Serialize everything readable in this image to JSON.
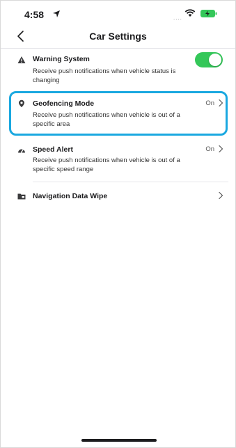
{
  "status_bar": {
    "time": "4:58",
    "signal_dots": "....",
    "icons": [
      "location-arrow-icon",
      "wifi-icon",
      "battery-charging-icon"
    ]
  },
  "nav": {
    "title": "Car Settings",
    "back_icon": "chevron-left-icon"
  },
  "settings": [
    {
      "title": "Warning System",
      "description": "Receive push notifications when vehicle status is changing",
      "icon": "warning-triangle-icon",
      "control": "toggle",
      "toggle_on": true
    },
    {
      "title": "Geofencing Mode",
      "description": "Receive push notifications when vehicle is out of a specific area",
      "icon": "location-pin-icon",
      "value": "On",
      "highlighted": true
    },
    {
      "title": "Speed Alert",
      "description": "Receive push notifications when vehicle is out of a specific speed range",
      "icon": "speedometer-icon",
      "value": "On"
    },
    {
      "title": "Navigation Data Wipe",
      "icon": "folder-icon"
    }
  ],
  "colors": {
    "toggle_on": "#34c759",
    "highlight_border": "#1aa8e0",
    "battery": "#34c759"
  }
}
